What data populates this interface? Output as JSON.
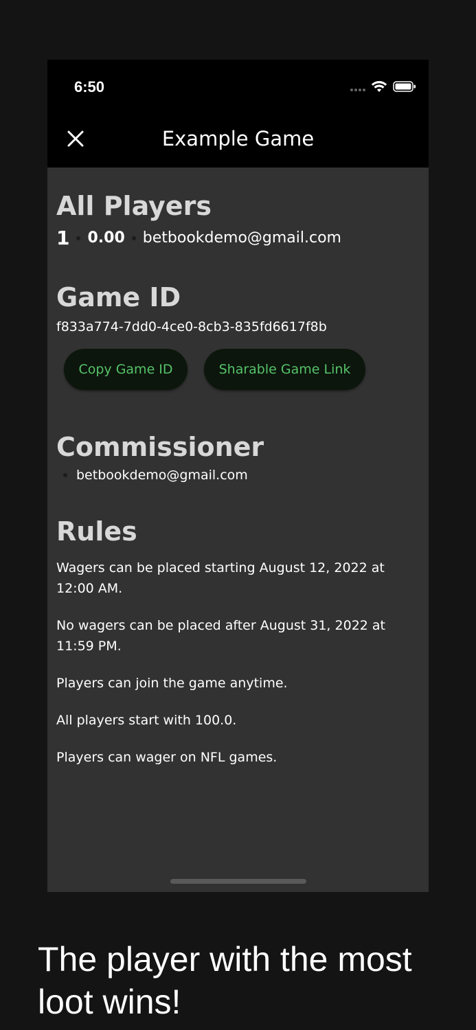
{
  "status_bar": {
    "time": "6:50"
  },
  "nav": {
    "title": "Example Game",
    "close_icon": "close-icon"
  },
  "players": {
    "heading": "All Players",
    "rows": [
      {
        "rank": "1",
        "balance": "0.00",
        "email": "betbookdemo@gmail.com"
      }
    ]
  },
  "game_id": {
    "heading": "Game ID",
    "value": "f833a774-7dd0-4ce0-8cb3-835fd6617f8b",
    "copy_label": "Copy Game ID",
    "share_label": "Sharable Game Link"
  },
  "commissioner": {
    "heading": "Commissioner",
    "items": [
      "betbookdemo@gmail.com"
    ]
  },
  "rules": {
    "heading": "Rules",
    "items": [
      "Wagers can be placed starting August 12, 2022 at 12:00 AM.",
      "No wagers can be placed after August 31, 2022 at 11:59 PM.",
      "Players can join the game anytime.",
      "All players start with 100.0.",
      "Players can wager on NFL games."
    ]
  },
  "caption": "The player with the most loot wins!",
  "colors": {
    "accent_green": "#56c26a",
    "button_bg": "#0c160c",
    "panel_bg": "#323232",
    "bar_bg": "#000000"
  }
}
